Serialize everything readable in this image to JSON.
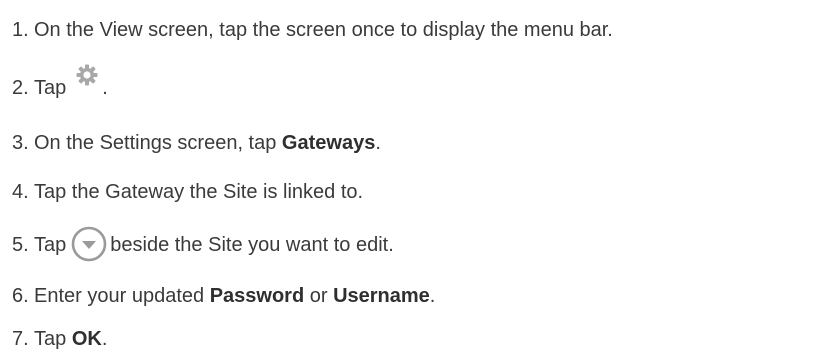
{
  "steps": [
    {
      "num": "1.",
      "text": "On the View screen, tap the screen once to display the menu bar."
    },
    {
      "num": "2.",
      "before": "Tap",
      "icon": "gear-icon",
      "after": "."
    },
    {
      "num": "3.",
      "before": "On the Settings screen, tap ",
      "bold": "Gateways",
      "after": "."
    },
    {
      "num": "4.",
      "text": "Tap the Gateway the Site is linked to."
    },
    {
      "num": "5.",
      "before": "Tap",
      "icon": "chevron-down-circle-icon",
      "after": "beside the Site you want to edit."
    },
    {
      "num": "6.",
      "before": "Enter your updated ",
      "bold": "Password",
      "middle": " or ",
      "bold2": "Username",
      "after": "."
    },
    {
      "num": "7.",
      "before": "Tap ",
      "bold": "OK",
      "after": "."
    }
  ],
  "colors": {
    "text": "#3a3a3a",
    "icon_gray": "#9a9a9a"
  }
}
